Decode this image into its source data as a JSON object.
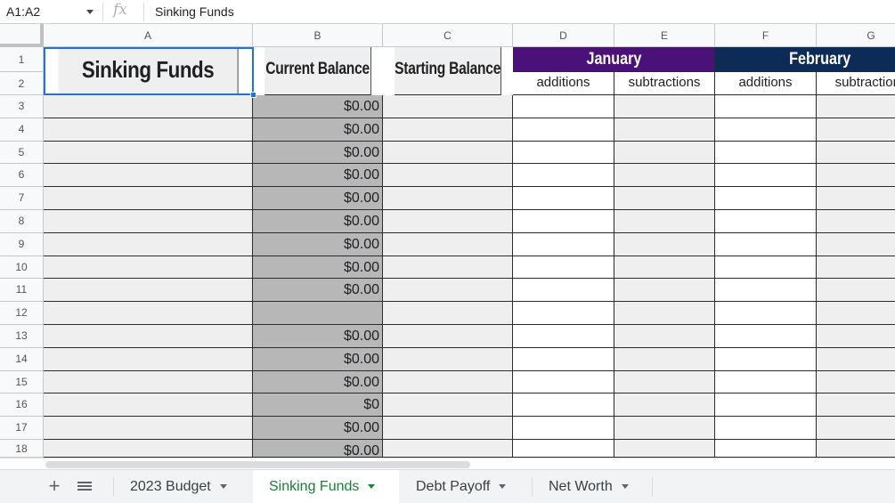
{
  "formula_bar": {
    "name_box": "A1:A2",
    "fx_label": "fx",
    "content": "Sinking Funds"
  },
  "columns": [
    "A",
    "B",
    "C",
    "D",
    "E",
    "F",
    "G"
  ],
  "rows": [
    "1",
    "2",
    "3",
    "4",
    "5",
    "6",
    "7",
    "8",
    "9",
    "10",
    "11",
    "12",
    "13",
    "14",
    "15",
    "16",
    "17",
    "18"
  ],
  "headers": {
    "a": "Sinking Funds",
    "b": "Current Balance",
    "c": "Starting Balance",
    "months": [
      {
        "name": "January",
        "color": "#4a1178",
        "additions": "additions",
        "subtractions": "subtractions"
      },
      {
        "name": "February",
        "color": "#0c2b57",
        "additions": "additions",
        "subtractions": "subtractions"
      }
    ]
  },
  "current_balance": [
    "$0.00",
    "$0.00",
    "$0.00",
    "$0.00",
    "$0.00",
    "$0.00",
    "$0.00",
    "$0.00",
    "$0.00",
    "",
    "$0.00",
    "$0.00",
    "$0.00",
    "$0",
    "$0.00",
    "$0.00"
  ],
  "sheet_tabs": [
    {
      "label": "2023 Budget",
      "active": false
    },
    {
      "label": "Sinking Funds",
      "active": true
    },
    {
      "label": "Debt Payoff",
      "active": false
    },
    {
      "label": "Net Worth",
      "active": false
    }
  ],
  "colors": {
    "selection": "#1a73e8",
    "active_tab": "#188038",
    "balance_fill": "#b7b7b7"
  }
}
